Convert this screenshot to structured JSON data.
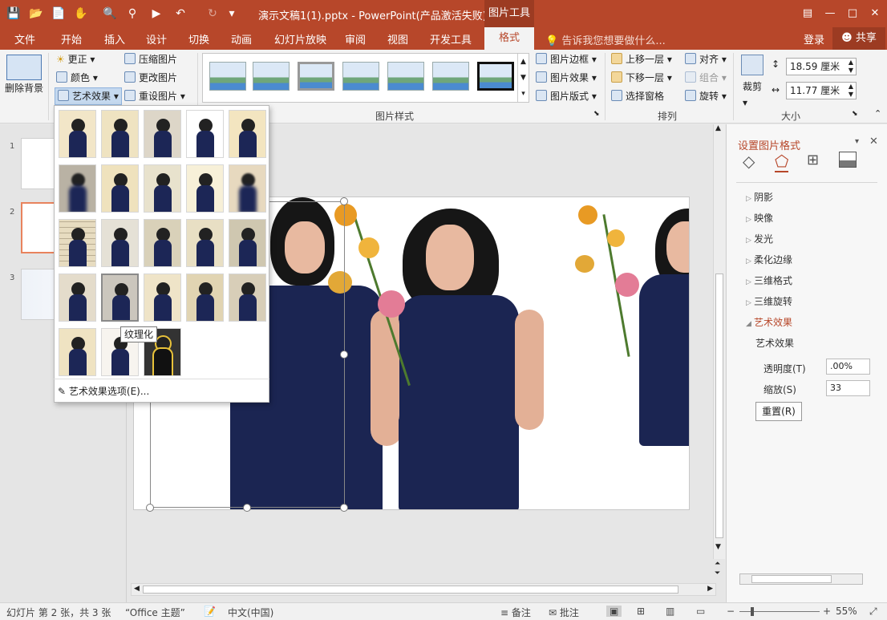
{
  "titlebar": {
    "doc_title": "演示文稿1(1).pptx - PowerPoint(产品激活失败)",
    "tools_tab": "图片工具",
    "save_icon": "save-icon",
    "accent": "#b7472a"
  },
  "tabs": {
    "items": [
      "文件",
      "开始",
      "插入",
      "设计",
      "切换",
      "动画",
      "幻灯片放映",
      "审阅",
      "视图",
      "开发工具"
    ],
    "active": "格式",
    "tell_me": "告诉我您想要做什么...",
    "login": "登录",
    "share": "共享"
  },
  "ribbon": {
    "remove_bg": "删除背景",
    "correct": "更正",
    "color": "颜色",
    "artistic": "艺术效果",
    "compress": "压缩图片",
    "change": "更改图片",
    "reset_pic": "重设图片",
    "border": "图片边框",
    "effects": "图片效果",
    "layout": "图片版式",
    "bring_forward": "上移一层",
    "send_backward": "下移一层",
    "selection_pane": "选择窗格",
    "align": "对齐",
    "group": "组合",
    "rotate": "旋转",
    "crop": "裁剪",
    "height": "18.59 厘米",
    "width": "11.77 厘米",
    "group_styles": "图片样式",
    "group_arrange": "排列",
    "group_size": "大小"
  },
  "thumbnails": {
    "nums": [
      "1",
      "2",
      "3"
    ]
  },
  "dropdown": {
    "tooltip": "纹理化",
    "options_label": "艺术效果选项(E)..."
  },
  "pane": {
    "title": "设置图片格式",
    "sections": [
      "阴影",
      "映像",
      "发光",
      "柔化边缘",
      "三维格式",
      "三维旋转",
      "艺术效果"
    ],
    "sub_title": "艺术效果",
    "transparency_label": "透明度(T)",
    "transparency_value": ".00%",
    "scale_label": "缩放(S)",
    "scale_value": "33",
    "reset": "重置(R)"
  },
  "status": {
    "slide_info": "幻灯片 第 2 张，共 3 张",
    "theme": "“Office 主题”",
    "language": "中文(中国)",
    "notes": "备注",
    "comments": "批注",
    "zoom": "55%"
  }
}
